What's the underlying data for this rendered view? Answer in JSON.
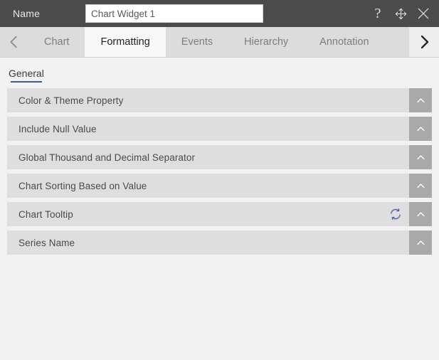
{
  "titlebar": {
    "name_label": "Name",
    "widget_name_value": "Chart Widget 1",
    "widget_name_placeholder": "Chart Widget 1",
    "help_glyph": "?",
    "icons": {
      "help": "help-icon",
      "move": "move-icon",
      "close": "close-icon"
    }
  },
  "tabbar": {
    "prev_icon": "chevron-left-icon",
    "next_icon": "chevron-right-icon",
    "tabs": [
      {
        "label": "Chart",
        "active": false
      },
      {
        "label": "Formatting",
        "active": true
      },
      {
        "label": "Events",
        "active": false
      },
      {
        "label": "Hierarchy",
        "active": false
      },
      {
        "label": "Annotation",
        "active": false
      }
    ]
  },
  "subtabs": [
    {
      "label": "General",
      "active": true
    }
  ],
  "accordion": {
    "toggle_icon": "chevron-up-icon",
    "refresh_icon": "refresh-icon",
    "sections": [
      {
        "title": "Color & Theme Property",
        "has_refresh": false,
        "expanded": false
      },
      {
        "title": "Include Null Value",
        "has_refresh": false,
        "expanded": false
      },
      {
        "title": "Global Thousand and Decimal Separator",
        "has_refresh": false,
        "expanded": false
      },
      {
        "title": "Chart Sorting Based on Value",
        "has_refresh": false,
        "expanded": false
      },
      {
        "title": "Chart Tooltip",
        "has_refresh": true,
        "expanded": false
      },
      {
        "title": "Series Name",
        "has_refresh": false,
        "expanded": false
      }
    ]
  },
  "colors": {
    "titlebar_bg": "#4c4c4c",
    "tabstrip_bg": "#dcdcdc",
    "active_tab_bg": "#f7f7f7",
    "page_bg": "#f2f2f2",
    "row_bg": "#dedede",
    "toggle_bg": "#a9a9a9",
    "accent_underline": "#3b5998",
    "refresh_blue": "#4a5fa5"
  }
}
